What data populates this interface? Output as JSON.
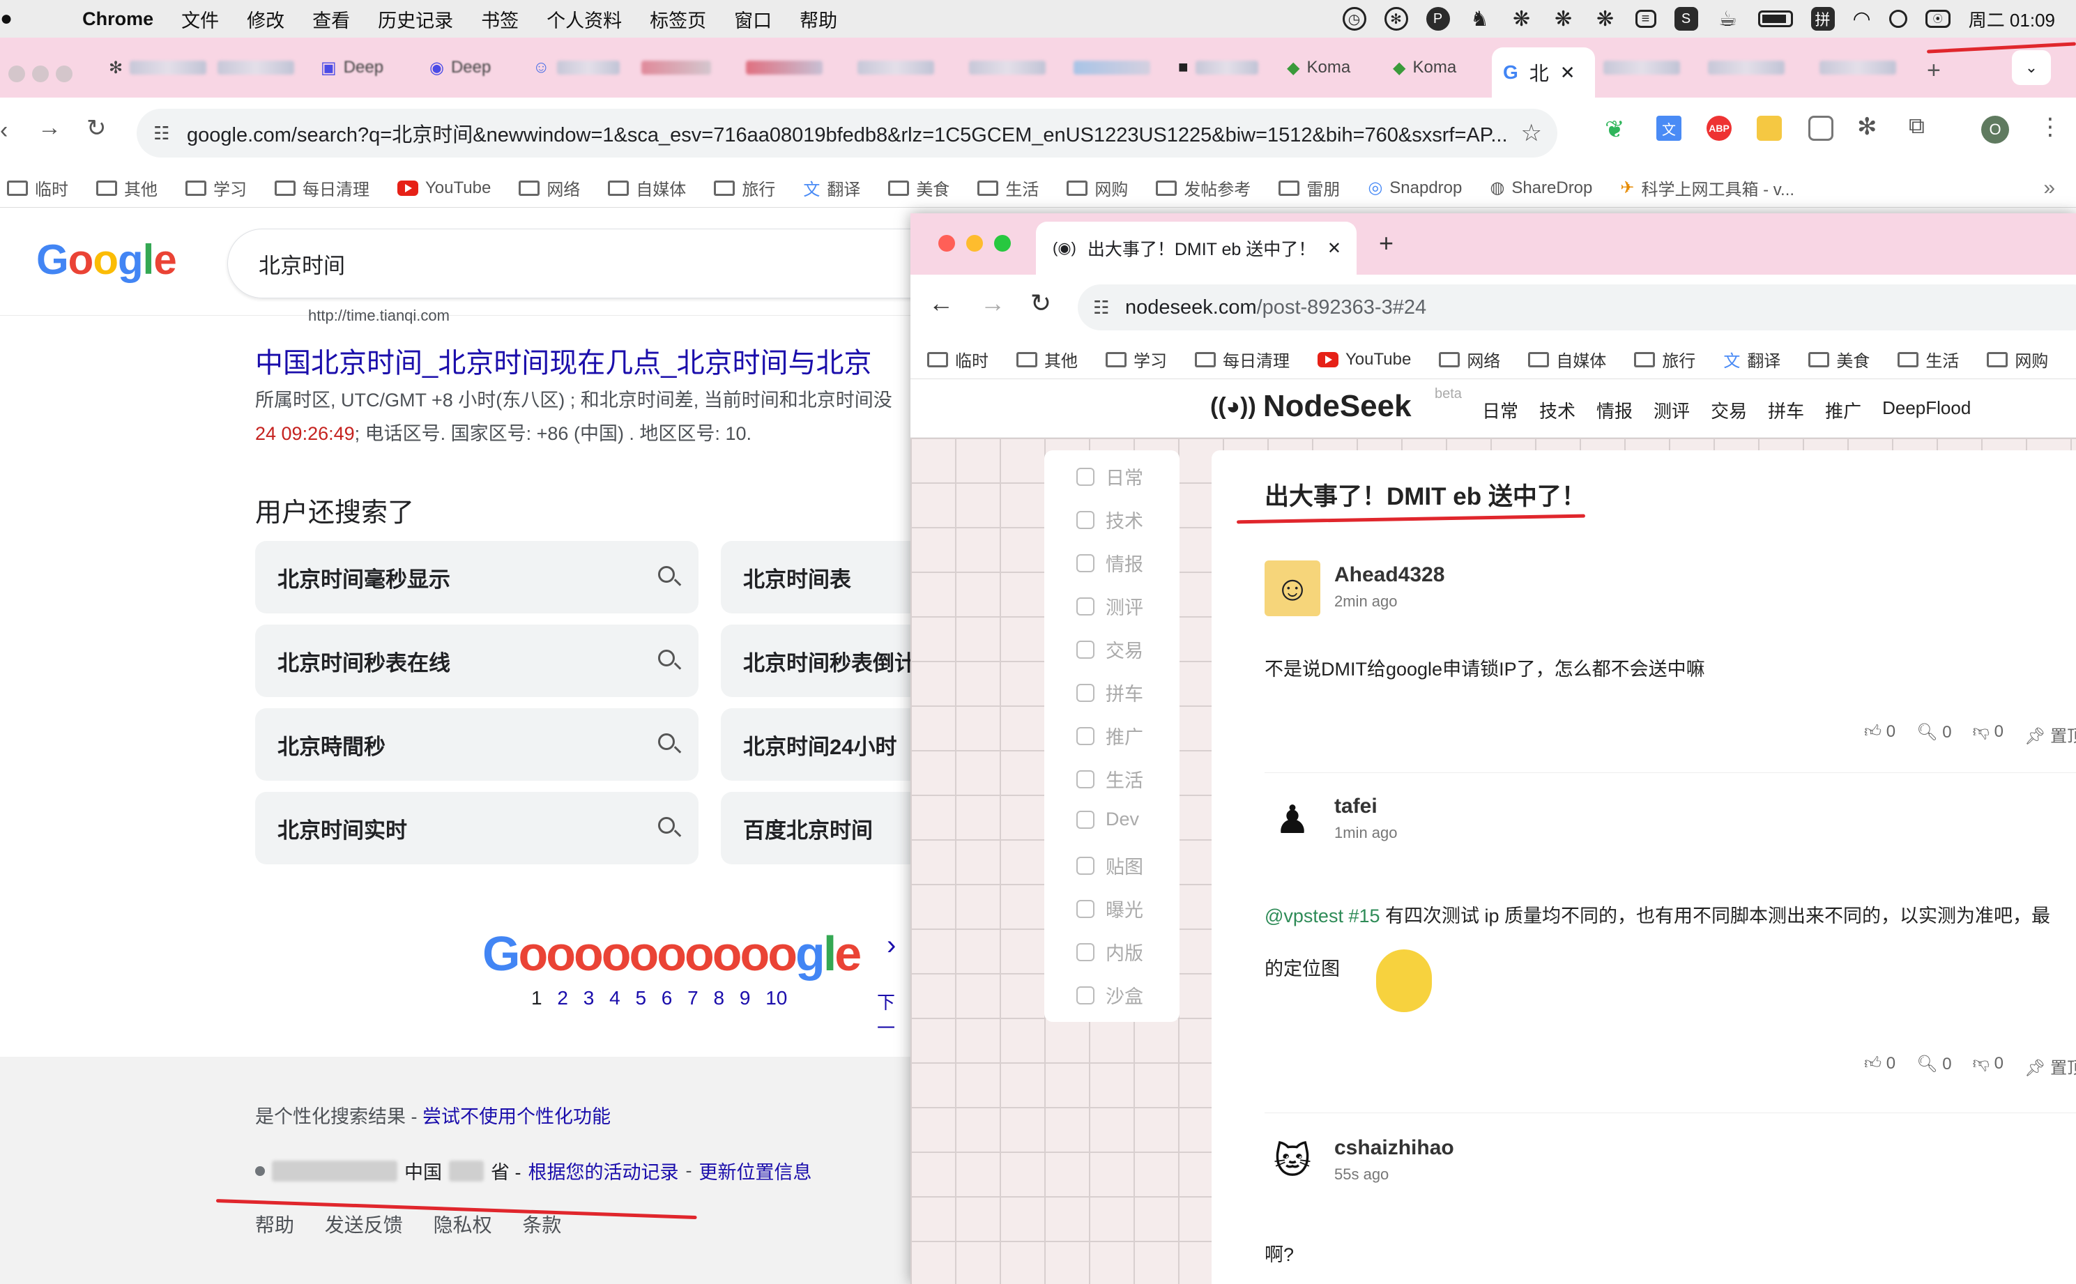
{
  "menubar": {
    "items": [
      "Chrome",
      "文件",
      "修改",
      "查看",
      "历史记录",
      "书签",
      "个人资料",
      "标签页",
      "窗口",
      "帮助"
    ],
    "clock": "周二 01:09"
  },
  "back_window": {
    "tabs": [
      "Deep",
      "Deep",
      "Koma",
      "Koma"
    ],
    "active_tab": "北",
    "url": "google.com/search?q=北京时间&newwindow=1&sca_esv=716aa08019bfedb8&rlz=1C5GCEM_enUS1223US1225&biw=1512&bih=760&sxsrf=AP...",
    "bookmarks": [
      "临时",
      "其他",
      "学习",
      "每日清理",
      "YouTube",
      "网络",
      "自媒体",
      "旅行",
      "翻译",
      "美食",
      "生活",
      "网购",
      "发帖参考",
      "雷朋",
      "Snapdrop",
      "ShareDrop",
      "科学上网工具箱 - v..."
    ],
    "profile_initial": "O"
  },
  "google": {
    "logo": "Google",
    "query": "北京时间",
    "result_url": "http://time.tianqi.com",
    "result_title": "中国北京时间_北京时间现在几点_北京时间与北京",
    "snippet1": "所属时区, UTC/GMT +8 小时(东八区) ; 和北京时间差, 当前时间和北京时间没",
    "snippet2_red": "24 09:26:49",
    "snippet2_rest": "; 电话区号. 国家区号: +86 (中国) . 地区区号: 10.",
    "also_title": "用户还搜索了",
    "chips_left": [
      "北京时间毫秒显示",
      "北京时间秒表在线",
      "北京時間秒",
      "北京时间实时"
    ],
    "chips_right": [
      "北京时间表",
      "北京时间秒表倒计",
      "北京时间24小时",
      "百度北京时间"
    ],
    "pager_logo": "Goooooooooogle",
    "pages": [
      "1",
      "2",
      "3",
      "4",
      "5",
      "6",
      "7",
      "8",
      "9",
      "10"
    ],
    "next": "下一",
    "personal_text": "是个性化搜索结果 - ",
    "personal_link": "尝试不使用个性化功能",
    "loc_country": "中国",
    "loc_province": "省 - ",
    "loc_link1": "根据您的活动记录",
    "loc_sep": " - ",
    "loc_link2": "更新位置信息",
    "footer_links": [
      "帮助",
      "发送反馈",
      "隐私权",
      "条款"
    ]
  },
  "front_window": {
    "tab_title": "出大事了！DMIT eb 送中了！",
    "url_host": "nodeseek.com",
    "url_path": "/post-892363-3#24",
    "bookmarks": [
      "临时",
      "其他",
      "学习",
      "每日清理",
      "YouTube",
      "网络",
      "自媒体",
      "旅行",
      "翻译",
      "美食",
      "生活",
      "网购"
    ],
    "logo": "NodeSeek",
    "beta": "beta",
    "nav": [
      "日常",
      "技术",
      "情报",
      "测评",
      "交易",
      "拼车",
      "推广",
      "DeepFlood"
    ],
    "sidenav": [
      "日常",
      "技术",
      "情报",
      "测评",
      "交易",
      "拼车",
      "推广",
      "生活",
      "Dev",
      "贴图",
      "曝光",
      "内版",
      "沙盒"
    ],
    "post_title": "出大事了！DMIT eb 送中了！",
    "replies": [
      {
        "user": "Ahead4328",
        "time": "2min ago",
        "text": "不是说DMIT给google申请锁IP了，怎么都不会送中嘛",
        "likes": "0",
        "comments": "0",
        "dislikes": "0",
        "pin": "置顶"
      },
      {
        "user": "tafei",
        "time": "1min ago",
        "mention": "@vpstest #15",
        "text": " 有四次测试 ip 质量均不同的，也有用不同脚本测出来不同的，以实测为准吧，最",
        "text2": "的定位图",
        "likes": "0",
        "comments": "0",
        "dislikes": "0",
        "pin": "置顶"
      },
      {
        "user": "cshaizhihao",
        "time": "55s ago",
        "text": "啊?"
      }
    ]
  },
  "colors": {
    "annotation_red": "#e0262c",
    "tabstrip_pink": "#f8d6e4",
    "link_blue": "#1a0dab"
  }
}
